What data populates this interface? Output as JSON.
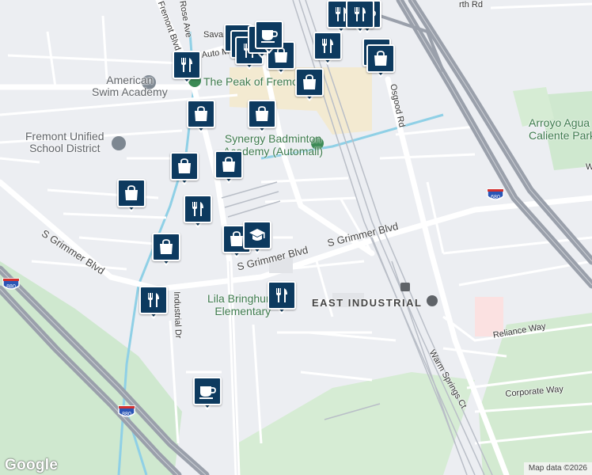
{
  "map": {
    "labels": {
      "pois": [
        {
          "id": "american-swim-academy",
          "lines": [
            "American",
            "Swim Academy"
          ]
        },
        {
          "id": "fremont-unified",
          "lines": [
            "Fremont Unified",
            "School District"
          ]
        },
        {
          "id": "peak-of-fremont",
          "lines": [
            "The Peak of Fremont"
          ]
        },
        {
          "id": "synergy-badminton",
          "lines": [
            "Synergy Badminton",
            "Academy (Automall)"
          ]
        },
        {
          "id": "lila-bringhurst",
          "lines": [
            "Lila Bringhurst",
            "Elementary"
          ]
        },
        {
          "id": "arroyo-agua",
          "lines": [
            "Arroyo Agua",
            "Caliente Park"
          ]
        }
      ],
      "streets": {
        "s_grimmer_1": "S Grimmer Blvd",
        "s_grimmer_2": "S Grimmer Blvd",
        "s_grimmer_3": "S Grimmer Blvd",
        "osgood": "Osgood Rd",
        "industrial": "Industrial Dr",
        "warm_springs": "Warm Springs Ct",
        "reliance": "Reliance Way",
        "corporate": "Corporate Way",
        "fremont_blvd": "Fremont Blvd",
        "rose_ave": "Rose Ave",
        "savannah": "Savann",
        "auto_mall": "Auto M",
        "top_right_rd": "rth Rd",
        "edge_w": "W",
        "dist_east_industrial": "EAST INDUSTRIAL"
      },
      "shields": {
        "i680": "680",
        "i880": "880",
        "i880b": "880"
      }
    },
    "markers": [
      {
        "icon": "restaurant-icon"
      },
      {
        "icon": "restaurant-icon"
      },
      {
        "icon": "restaurant-icon"
      },
      {
        "icon": "restaurant-icon"
      },
      {
        "icon": "shopping-bag-icon"
      },
      {
        "icon": "coffee-icon"
      },
      {
        "icon": "restaurant-icon"
      },
      {
        "icon": "coffee-icon"
      },
      {
        "icon": "restaurant-icon"
      },
      {
        "icon": "restaurant-icon"
      },
      {
        "icon": "restaurant-icon"
      },
      {
        "icon": "shopping-bag-icon"
      },
      {
        "icon": "shopping-bag-icon"
      },
      {
        "icon": "shopping-bag-icon"
      },
      {
        "icon": "shopping-bag-icon"
      },
      {
        "icon": "shopping-bag-icon"
      },
      {
        "icon": "shopping-bag-icon"
      },
      {
        "icon": "shopping-bag-icon"
      },
      {
        "icon": "shopping-bag-icon"
      },
      {
        "icon": "restaurant-icon"
      },
      {
        "icon": "shopping-bag-icon"
      },
      {
        "icon": "shopping-bag-icon"
      },
      {
        "icon": "school-icon"
      },
      {
        "icon": "restaurant-icon"
      },
      {
        "icon": "restaurant-icon"
      },
      {
        "icon": "coffee-icon"
      }
    ],
    "footer": {
      "logo": "Google",
      "attribution": "Map data ©2026"
    }
  }
}
